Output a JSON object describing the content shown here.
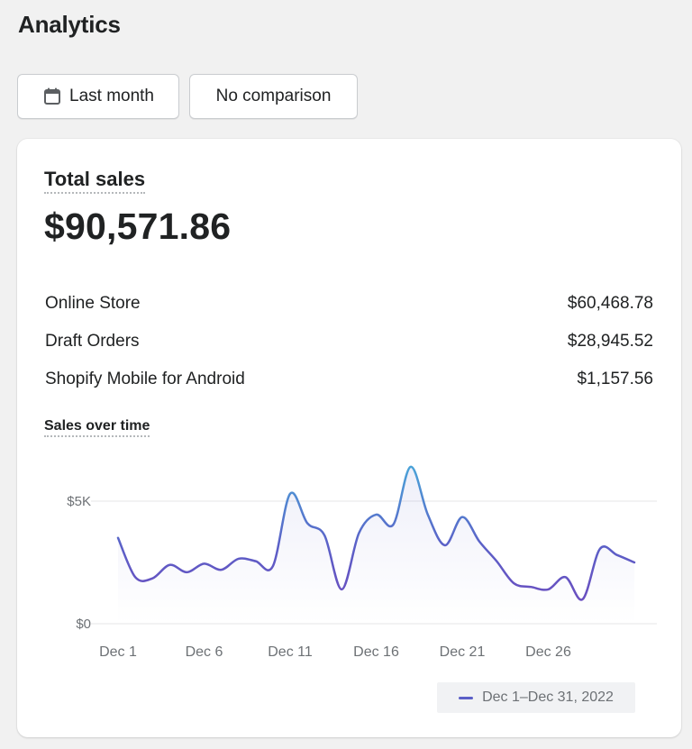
{
  "page": {
    "title": "Analytics"
  },
  "filters": {
    "date_range_label": "Last month",
    "date_icon": "calendar-icon",
    "comparison_label": "No comparison"
  },
  "card": {
    "title": "Total sales",
    "total_value": "$90,571.86",
    "breakdown": [
      {
        "label": "Online Store",
        "value": "$60,468.78"
      },
      {
        "label": "Draft Orders",
        "value": "$28,945.52"
      },
      {
        "label": "Shopify Mobile for Android",
        "value": "$1,157.56"
      }
    ],
    "chart_title": "Sales over time"
  },
  "chart_data": {
    "type": "line",
    "title": "Sales over time",
    "ylim": [
      0,
      5000
    ],
    "yticks": [
      {
        "value": 0,
        "label": "$0"
      },
      {
        "value": 5000,
        "label": "$5K"
      }
    ],
    "x": [
      "Dec 1",
      "Dec 2",
      "Dec 3",
      "Dec 4",
      "Dec 5",
      "Dec 6",
      "Dec 7",
      "Dec 8",
      "Dec 9",
      "Dec 10",
      "Dec 11",
      "Dec 12",
      "Dec 13",
      "Dec 14",
      "Dec 15",
      "Dec 16",
      "Dec 17",
      "Dec 18",
      "Dec 19",
      "Dec 20",
      "Dec 21",
      "Dec 22",
      "Dec 23",
      "Dec 24",
      "Dec 25",
      "Dec 26",
      "Dec 27",
      "Dec 28",
      "Dec 29",
      "Dec 30",
      "Dec 31"
    ],
    "xtick_labels": [
      "Dec 1",
      "Dec 6",
      "Dec 11",
      "Dec 16",
      "Dec 21",
      "Dec 26"
    ],
    "series": [
      {
        "name": "Dec 1–Dec 31, 2022",
        "color": "#5b5fc7",
        "values": [
          3500,
          1900,
          1850,
          2400,
          2100,
          2450,
          2200,
          2650,
          2550,
          2350,
          5300,
          4100,
          3600,
          1400,
          3700,
          4450,
          4050,
          6400,
          4450,
          3200,
          4350,
          3350,
          2550,
          1650,
          1500,
          1400,
          1900,
          1000,
          3050,
          2800,
          2500
        ]
      }
    ],
    "legend": {
      "position": "bottom-right",
      "label": "Dec 1–Dec 31, 2022"
    },
    "grid": true
  }
}
